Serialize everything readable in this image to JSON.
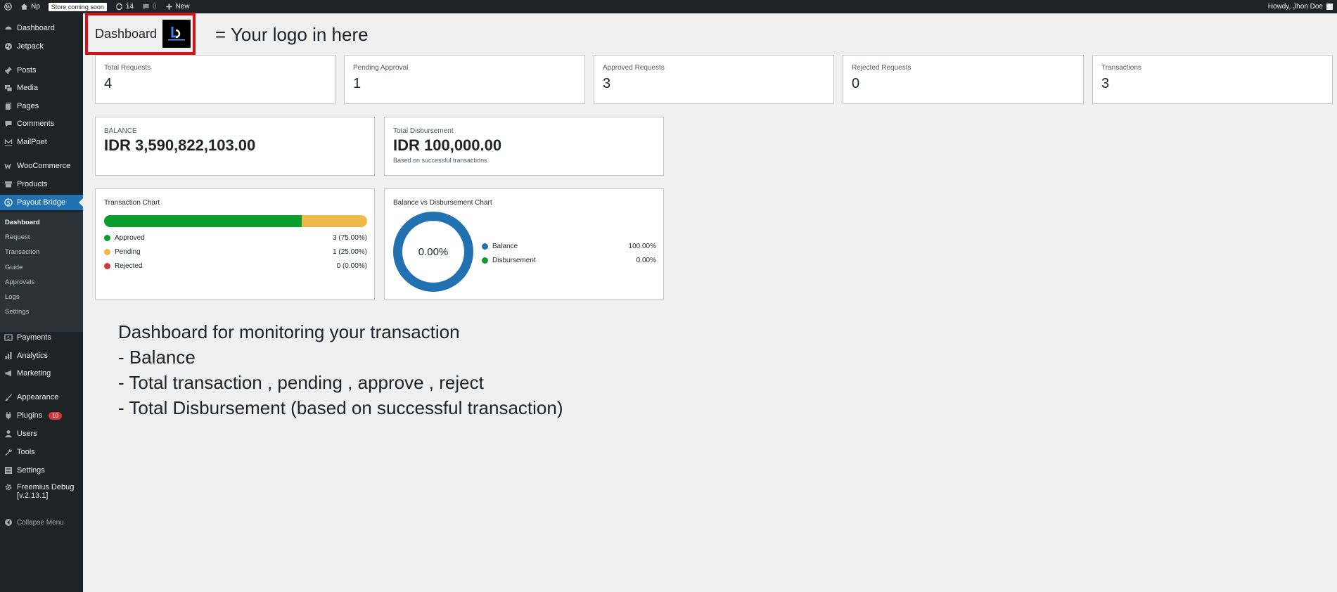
{
  "adminbar": {
    "site_name": "Np",
    "store_status": "Store coming soon",
    "updates_count": "14",
    "comments_count": "0",
    "new_label": "New",
    "howdy": "Howdy, Jhon Doe"
  },
  "sidebar": {
    "items": [
      {
        "label": "Dashboard",
        "icon": "gauge-icon"
      },
      {
        "label": "Jetpack",
        "icon": "jetpack-icon"
      },
      {
        "label": "Posts",
        "icon": "pin-icon"
      },
      {
        "label": "Media",
        "icon": "media-icon"
      },
      {
        "label": "Pages",
        "icon": "page-icon"
      },
      {
        "label": "Comments",
        "icon": "comment-icon"
      },
      {
        "label": "MailPoet",
        "icon": "mailpoet-icon"
      },
      {
        "label": "WooCommerce",
        "icon": "woo-icon"
      },
      {
        "label": "Products",
        "icon": "archive-icon"
      },
      {
        "label": "Payout Bridge",
        "icon": "dollar-icon"
      },
      {
        "label": "Payments",
        "icon": "payments-icon"
      },
      {
        "label": "Analytics",
        "icon": "chart-icon"
      },
      {
        "label": "Marketing",
        "icon": "megaphone-icon"
      },
      {
        "label": "Appearance",
        "icon": "brush-icon"
      },
      {
        "label": "Plugins",
        "icon": "plug-icon",
        "badge": "10"
      },
      {
        "label": "Users",
        "icon": "user-icon"
      },
      {
        "label": "Tools",
        "icon": "wrench-icon"
      },
      {
        "label": "Settings",
        "icon": "settings-icon"
      },
      {
        "label": "Freemius Debug",
        "label2": "[v.2.13.1]",
        "icon": "gear-icon"
      },
      {
        "label": "Collapse Menu",
        "icon": "collapse-icon"
      }
    ],
    "submenu": [
      "Dashboard",
      "Request",
      "Transaction",
      "Guide",
      "Approvals",
      "Logs",
      "Settings"
    ]
  },
  "header": {
    "title": "Dashboard",
    "annotation": "= Your logo in here"
  },
  "stats": [
    {
      "label": "Total Requests",
      "value": "4"
    },
    {
      "label": "Pending Approval",
      "value": "1"
    },
    {
      "label": "Approved Requests",
      "value": "3"
    },
    {
      "label": "Rejected Requests",
      "value": "0"
    },
    {
      "label": "Transactions",
      "value": "3"
    }
  ],
  "balance": {
    "label": "BALANCE",
    "value": "IDR 3,590,822,103.00"
  },
  "disbursement": {
    "label": "Total Disbursement",
    "value": "IDR 100,000.00",
    "note": "Based on successful transactions."
  },
  "transaction_chart": {
    "title": "Transaction Chart",
    "rows": [
      {
        "label": "Approved",
        "value": "3 (75.00%)",
        "color": "#0a9e2e",
        "fraction": 0.75
      },
      {
        "label": "Pending",
        "value": "1 (25.00%)",
        "color": "#f0b849",
        "fraction": 0.25
      },
      {
        "label": "Rejected",
        "value": "0 (0.00%)",
        "color": "#d63638",
        "fraction": 0.0
      }
    ]
  },
  "balance_chart": {
    "title": "Balance vs Disbursement Chart",
    "center_label": "0.00%",
    "rows": [
      {
        "label": "Balance",
        "value": "100.00%",
        "color": "#2271b1",
        "fraction": 1.0
      },
      {
        "label": "Disbursement",
        "value": "0.00%",
        "color": "#0a9e2e",
        "fraction": 0.0
      }
    ]
  },
  "annotation_body": {
    "lines": [
      "Dashboard for monitoring your transaction",
      "- Balance",
      "- Total transaction , pending , approve , reject",
      "- Total Disbursement (based on successful transaction)"
    ]
  }
}
